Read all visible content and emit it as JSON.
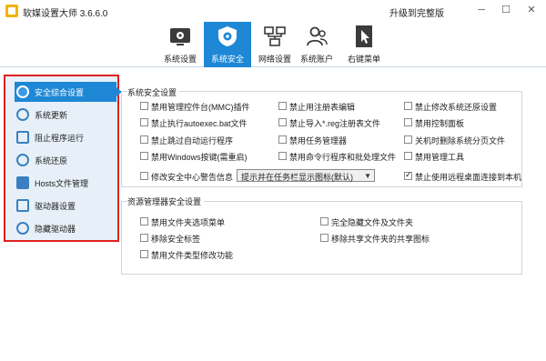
{
  "window": {
    "title": "软媒设置大师 3.6.6.0",
    "upgrade": "升级到完整版",
    "min": "─",
    "max": "☐",
    "close": "✕"
  },
  "toolbar": {
    "items": [
      {
        "label": "系统设置",
        "icon": "system-settings-icon"
      },
      {
        "label": "系统安全",
        "icon": "shield-gear-icon",
        "active": true
      },
      {
        "label": "网络设置",
        "icon": "network-icon"
      },
      {
        "label": "系统账户",
        "icon": "users-icon"
      },
      {
        "label": "右键菜单",
        "icon": "cursor-menu-icon"
      }
    ]
  },
  "sidebar": {
    "items": [
      {
        "label": "安全综合设置",
        "active": true
      },
      {
        "label": "系统更新"
      },
      {
        "label": "阻止程序运行"
      },
      {
        "label": "系统还原"
      },
      {
        "label": "Hosts文件管理"
      },
      {
        "label": "驱动器设置"
      },
      {
        "label": "隐藏驱动器"
      }
    ]
  },
  "system_security": {
    "title": "系统安全设置",
    "checkboxes": [
      {
        "label": "禁用管理控件台(MMC)插件",
        "checked": false
      },
      {
        "label": "禁止用注册表编辑",
        "checked": false
      },
      {
        "label": "禁止修改系统还原设置",
        "checked": false
      },
      {
        "label": "禁止执行autoexec.bat文件",
        "checked": false
      },
      {
        "label": "禁止导入*.reg注册表文件",
        "checked": false
      },
      {
        "label": "禁用控制面板",
        "checked": false
      },
      {
        "label": "禁止跳过自动运行程序",
        "checked": false
      },
      {
        "label": "禁用任务管理器",
        "checked": false
      },
      {
        "label": "关机时删除系统分页文件",
        "checked": false
      },
      {
        "label": "禁用Windows按键(需重启)",
        "checked": false
      },
      {
        "label": "禁用命令行程序和批处理文件",
        "checked": false
      },
      {
        "label": "禁用管理工具",
        "checked": false
      },
      {
        "label": "修改安全中心警告信息",
        "checked": false
      },
      {
        "label": "禁止使用远程桌面连接到本机",
        "checked": true
      }
    ],
    "select_value": "提示并在任务栏显示图标(默认)"
  },
  "explorer_security": {
    "title": "资源管理器安全设置",
    "checkboxes": [
      {
        "label": "禁用文件夹选项菜单",
        "checked": false
      },
      {
        "label": "完全隐藏文件及文件夹",
        "checked": false
      },
      {
        "label": "移除安全标签",
        "checked": false
      },
      {
        "label": "移除共享文件夹的共享图标",
        "checked": false
      },
      {
        "label": "禁用文件类型修改功能",
        "checked": false
      }
    ]
  }
}
